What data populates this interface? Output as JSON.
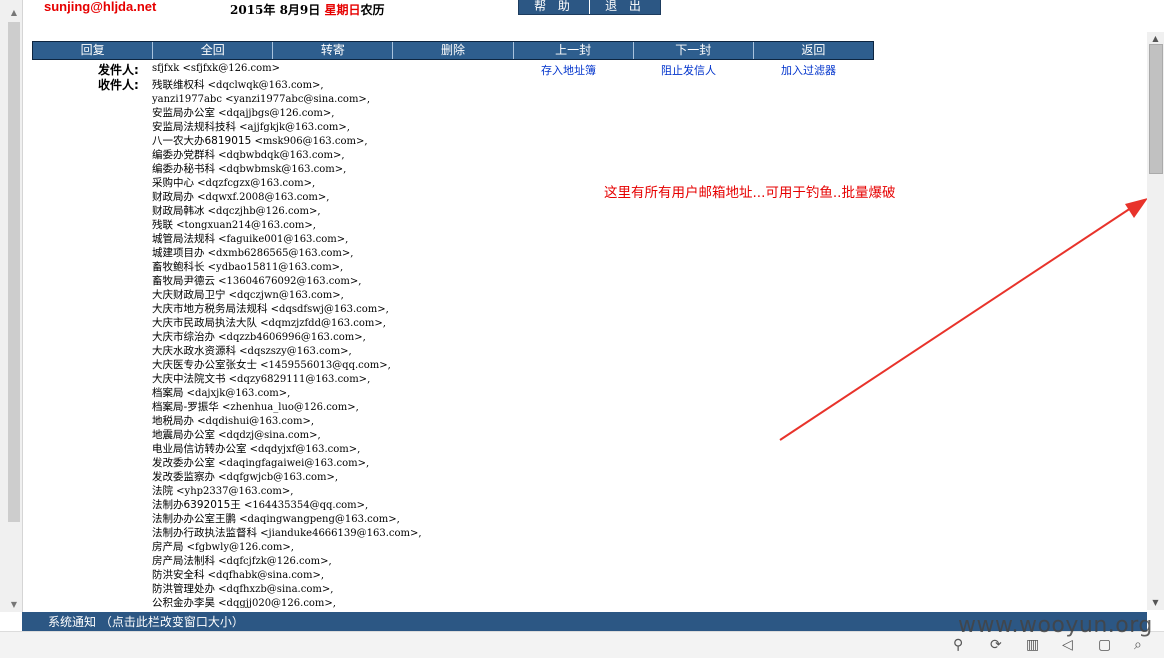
{
  "header": {
    "user_email": "sunjing@hljda.net",
    "date_prefix": "2015年  8月9日 ",
    "weekday": "星期日",
    "calendar": "农历"
  },
  "top_buttons": [
    "帮 助",
    "退 出"
  ],
  "toolbar": [
    "回复",
    "全回",
    "转寄",
    "删除",
    "上一封",
    "下一封",
    "返回"
  ],
  "mail": {
    "from_label": "发件人:",
    "from_value": "sfjfxk  <sfjfxk@126.com>",
    "to_label": "收件人:",
    "links": [
      "存入地址簿",
      "阻止发信人",
      "加入过滤器"
    ],
    "recipients": [
      {
        "name": "残联维权科",
        "addr": " <dqclwqk@163.com>,"
      },
      {
        "name": "",
        "addr": "yanzi1977abc <yanzi1977abc@sina.com>,"
      },
      {
        "name": "安监局办公室",
        "addr": " <dqajjbgs@126.com>,"
      },
      {
        "name": "安监局法规科技科",
        "addr": " <ajjfgkjk@163.com>,"
      },
      {
        "name": "八一农大办6819015",
        "addr": " <msk906@163.com>,"
      },
      {
        "name": "编委办党群科",
        "addr": " <dqbwbdqk@163.com>,"
      },
      {
        "name": "编委办秘书科",
        "addr": " <dqbwbmsk@163.com>,"
      },
      {
        "name": "采购中心",
        "addr": " <dqzfcgzx@163.com>,"
      },
      {
        "name": "财政局办",
        "addr": " <dqwxf.2008@163.com>,"
      },
      {
        "name": "财政局韩冰",
        "addr": " <dqczjhb@126.com>,"
      },
      {
        "name": "残联",
        "addr": " <tongxuan214@163.com>,"
      },
      {
        "name": "城管局法规科",
        "addr": " <faguike001@163.com>,"
      },
      {
        "name": "城建项目办",
        "addr": " <dxmb6286565@163.com>,"
      },
      {
        "name": "畜牧鲍科长",
        "addr": " <ydbao15811@163.com>,"
      },
      {
        "name": "畜牧局尹德云",
        "addr": " <13604676092@163.com>,"
      },
      {
        "name": "大庆财政局卫宁",
        "addr": " <dqczjwn@163.com>,"
      },
      {
        "name": "大庆市地方税务局法规科",
        "addr": " <dqsdfswj@163.com>,"
      },
      {
        "name": "大庆市民政局执法大队",
        "addr": " <dqmzjzfdd@163.com>,"
      },
      {
        "name": "大庆市综治办",
        "addr": " <dqzzb4606996@163.com>,"
      },
      {
        "name": "大庆水政水资源科",
        "addr": " <dqszszy@163.com>,"
      },
      {
        "name": "大庆医专办公室张女士",
        "addr": " <1459556013@qq.com>,"
      },
      {
        "name": "大庆中法院文书",
        "addr": " <dqzy6829111@163.com>,"
      },
      {
        "name": "档案局",
        "addr": " <dajxjk@163.com>,"
      },
      {
        "name": "档案局-罗振华",
        "addr": " <zhenhua_luo@126.com>,"
      },
      {
        "name": "地税局办",
        "addr": " <dqdishui@163.com>,"
      },
      {
        "name": "地震局办公室",
        "addr": " <dqdzj@sina.com>,"
      },
      {
        "name": "电业局信访转办公室",
        "addr": " <dqdyjxf@163.com>,"
      },
      {
        "name": "发改委办公室",
        "addr": " <daqingfagaiwei@163.com>,"
      },
      {
        "name": "发改委监察办",
        "addr": " <dqfgwjcb@163.com>,"
      },
      {
        "name": "法院",
        "addr": " <yhp2337@163.com>,"
      },
      {
        "name": "法制办6392015王",
        "addr": " <164435354@qq.com>,"
      },
      {
        "name": "法制办办公室王鹏",
        "addr": " <daqingwangpeng@163.com>,"
      },
      {
        "name": "法制办行政执法监督科",
        "addr": " <jianduke4666139@163.com>,"
      },
      {
        "name": "房产局",
        "addr": " <fgbwly@126.com>,"
      },
      {
        "name": "房产局法制科",
        "addr": " <dqfcjfzk@126.com>,"
      },
      {
        "name": "防洪安全科",
        "addr": " <dqfhabk@sina.com>,"
      },
      {
        "name": "防洪管理处办",
        "addr": " <dqfhxzb@sina.com>,"
      },
      {
        "name": "公积金办李昊",
        "addr": " <dqgjj020@126.com>,"
      }
    ]
  },
  "annotation": "这里有所有用户邮箱地址...可用于钓鱼..批量爆破",
  "bottom_bar": "系统通知 （点击此栏改变窗口大小）",
  "watermark": "www.wooyun.org",
  "colors": {
    "accent": "#2c5784",
    "annotation": "#e60000",
    "link": "#0033cc"
  }
}
